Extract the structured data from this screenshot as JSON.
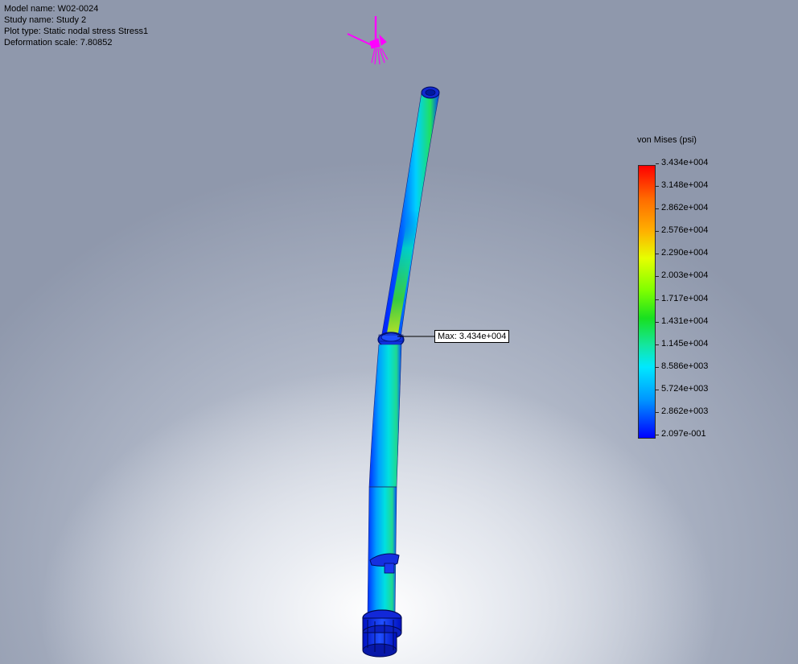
{
  "info": {
    "model_name": "Model name: W02-0024",
    "study_name": "Study name: Study 2",
    "plot_type": "Plot type: Static nodal stress Stress1",
    "deformation_scale": "Deformation scale: 7.80852"
  },
  "legend": {
    "title": "von Mises (psi)",
    "ticks": [
      "3.434e+004",
      "3.148e+004",
      "2.862e+004",
      "2.576e+004",
      "2.290e+004",
      "2.003e+004",
      "1.717e+004",
      "1.431e+004",
      "1.145e+004",
      "8.586e+003",
      "5.724e+003",
      "2.862e+003",
      "2.097e-001"
    ]
  },
  "max_marker": {
    "label": "Max: 3.434e+004"
  },
  "colors": {
    "load_arrows": "#ff00ff",
    "low_stress": "#0000ff",
    "high_stress": "#ff0000"
  }
}
